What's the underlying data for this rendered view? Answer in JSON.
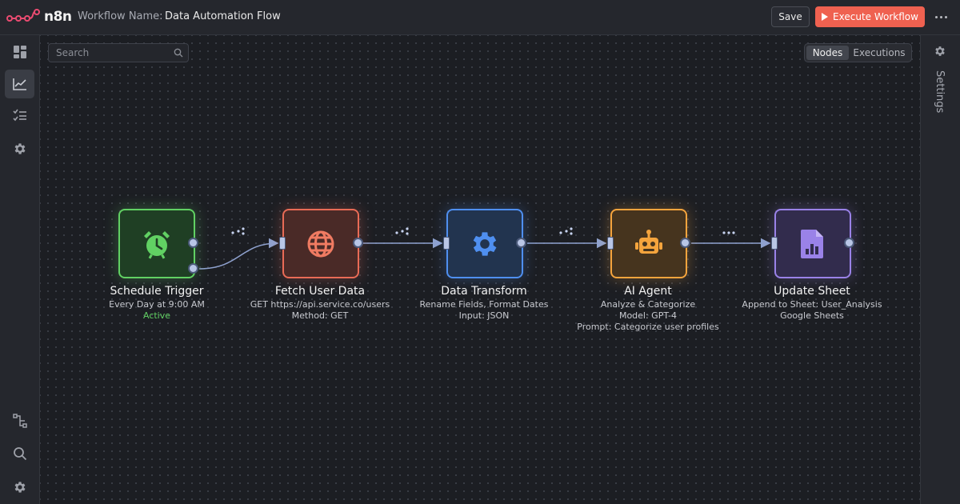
{
  "header": {
    "logo_text": "n8n",
    "workflow_name_label": "Workflow Name:",
    "workflow_name": "Data Automation Flow",
    "save_label": "Save",
    "execute_label": "Execute Workflow"
  },
  "canvas": {
    "search_placeholder": "Search",
    "tabs": [
      {
        "label": "Nodes",
        "active": true
      },
      {
        "label": "Executions",
        "active": false
      }
    ]
  },
  "right_panel": {
    "settings_label": "Settings"
  },
  "nodes": [
    {
      "title": "Schedule Trigger",
      "lines": [
        "Every Day at 9:00 AM"
      ],
      "status": "Active",
      "icon": "alarm-clock-icon",
      "color": "#61d163"
    },
    {
      "title": "Fetch User Data",
      "lines": [
        "GET https://api.service.co/users",
        "Method: GET"
      ],
      "icon": "globe-icon",
      "color": "#e96b56"
    },
    {
      "title": "Data Transform",
      "lines": [
        "Rename Fields, Format Dates",
        "Input: JSON"
      ],
      "icon": "gear-icon",
      "color": "#4f8ff0"
    },
    {
      "title": "AI Agent",
      "lines": [
        "Analyze & Categorize",
        "Model: GPT-4",
        "Prompt: Categorize user profiles"
      ],
      "icon": "robot-icon",
      "color": "#f5a43d"
    },
    {
      "title": "Update Sheet",
      "lines": [
        "Append to Sheet: User_Analysis",
        "Google Sheets"
      ],
      "icon": "spreadsheet-icon",
      "color": "#9a82e8"
    }
  ],
  "sidebar": {
    "items": [
      {
        "icon": "dashboard-icon"
      },
      {
        "icon": "chart-icon",
        "active": true
      },
      {
        "icon": "list-icon"
      },
      {
        "icon": "gear-icon"
      },
      {
        "icon": "workflow-icon"
      },
      {
        "icon": "search-icon"
      },
      {
        "icon": "gear-icon"
      }
    ]
  },
  "colors": {
    "accent": "#ef6150",
    "background": "#1c1e23"
  }
}
